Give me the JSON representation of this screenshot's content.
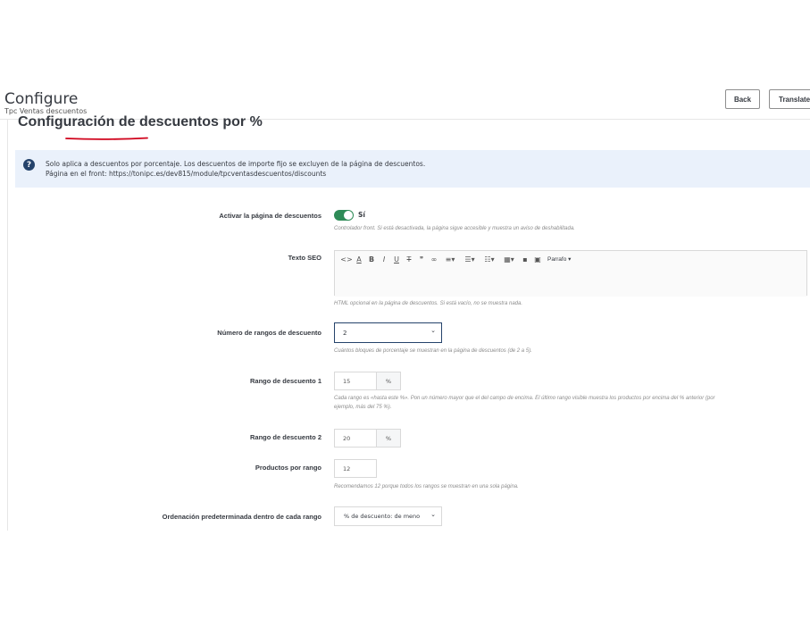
{
  "header": {
    "title": "Configure",
    "subtitle": "Tpc Ventas descuentos",
    "back_label": "Back",
    "translate_label": "Translate"
  },
  "card": {
    "title": "Configuración de descuentos por %"
  },
  "alert": {
    "line1": "Solo aplica a descuentos por porcentaje. Los descuentos de importe fijo se excluyen de la página de descuentos.",
    "line2": "Página en el front: https://tonipc.es/dev815/module/tpcventasdescuentos/discounts"
  },
  "form": {
    "enable_page": {
      "label": "Activar la página de descuentos",
      "value_label": "Sí",
      "enabled": true,
      "help": "Controlador front. Si está desactivada, la página sigue accesible y muestra un aviso de deshabilitada."
    },
    "seo_text": {
      "label": "Texto SEO",
      "paragraph_label": "Parrafo ▾",
      "help": "HTML opcional en la página de descuentos. Si está vacío, no se muestra nada."
    },
    "num_ranges": {
      "label": "Número de rangos de descuento",
      "value": "2",
      "help": "Cuántos bloques de porcentaje se muestran en la página de descuentos (de 2 a 5)."
    },
    "range1": {
      "label": "Rango de descuento 1",
      "value": "15",
      "unit": "%",
      "help_line1": "Cada rango es «hasta este %». Pon un número mayor que el del campo de encima. El último rango visible muestra los productos por encima del % anterior (por",
      "help_line2": "ejemplo, más del 75 %)."
    },
    "range2": {
      "label": "Rango de descuento 2",
      "value": "20",
      "unit": "%"
    },
    "products_per_range": {
      "label": "Productos por rango",
      "value": "12",
      "help": "Recomendamos 12 porque todos los rangos se muestran en una sola página."
    },
    "default_sort": {
      "label": "Ordenación predeterminada dentro de cada rango",
      "value": "% de descuento: de meno"
    }
  },
  "colors": {
    "toggle_on": "#2e8b57",
    "alert_bg": "#eaf1fb",
    "focus_border": "#25436b",
    "underline_red": "#d0021b"
  }
}
